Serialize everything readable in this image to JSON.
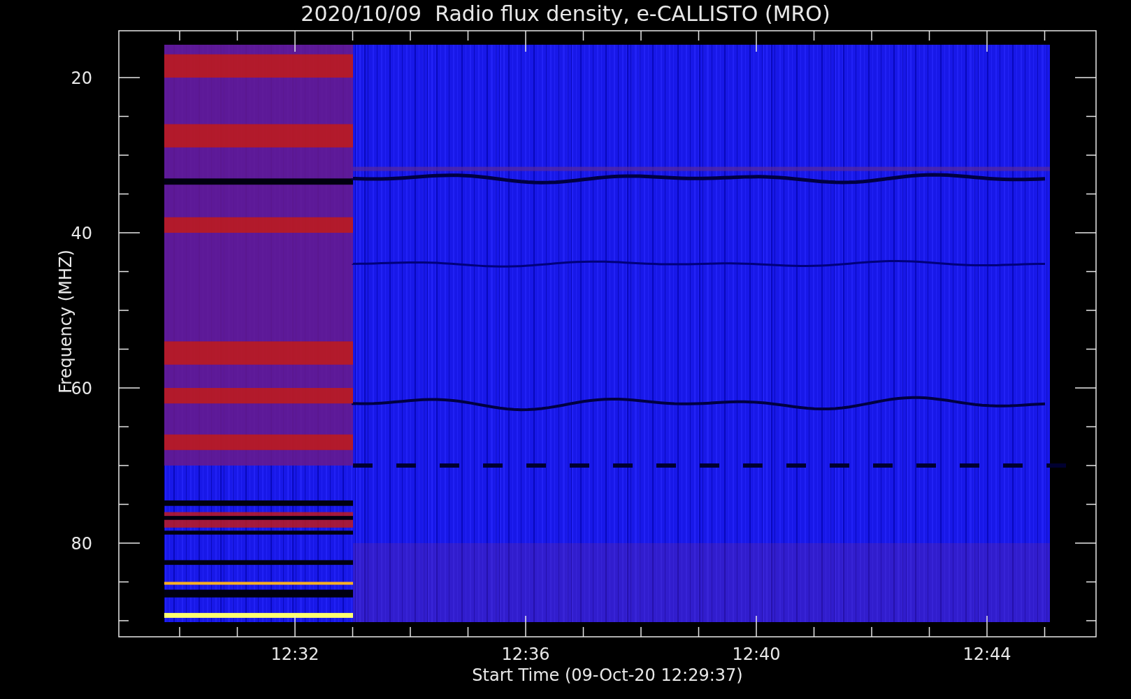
{
  "title": "2020/10/09  Radio flux density, e-CALLISTO (MRO)",
  "plot": {
    "y_label": "Frequency (MHZ)",
    "x_label": "Start Time (09-Oct-20 12:29:37)",
    "y_ticks": [
      "20",
      "40",
      "60",
      "80"
    ],
    "x_ticks": [
      "12:32",
      "12:36",
      "12:40",
      "12:44"
    ]
  }
}
